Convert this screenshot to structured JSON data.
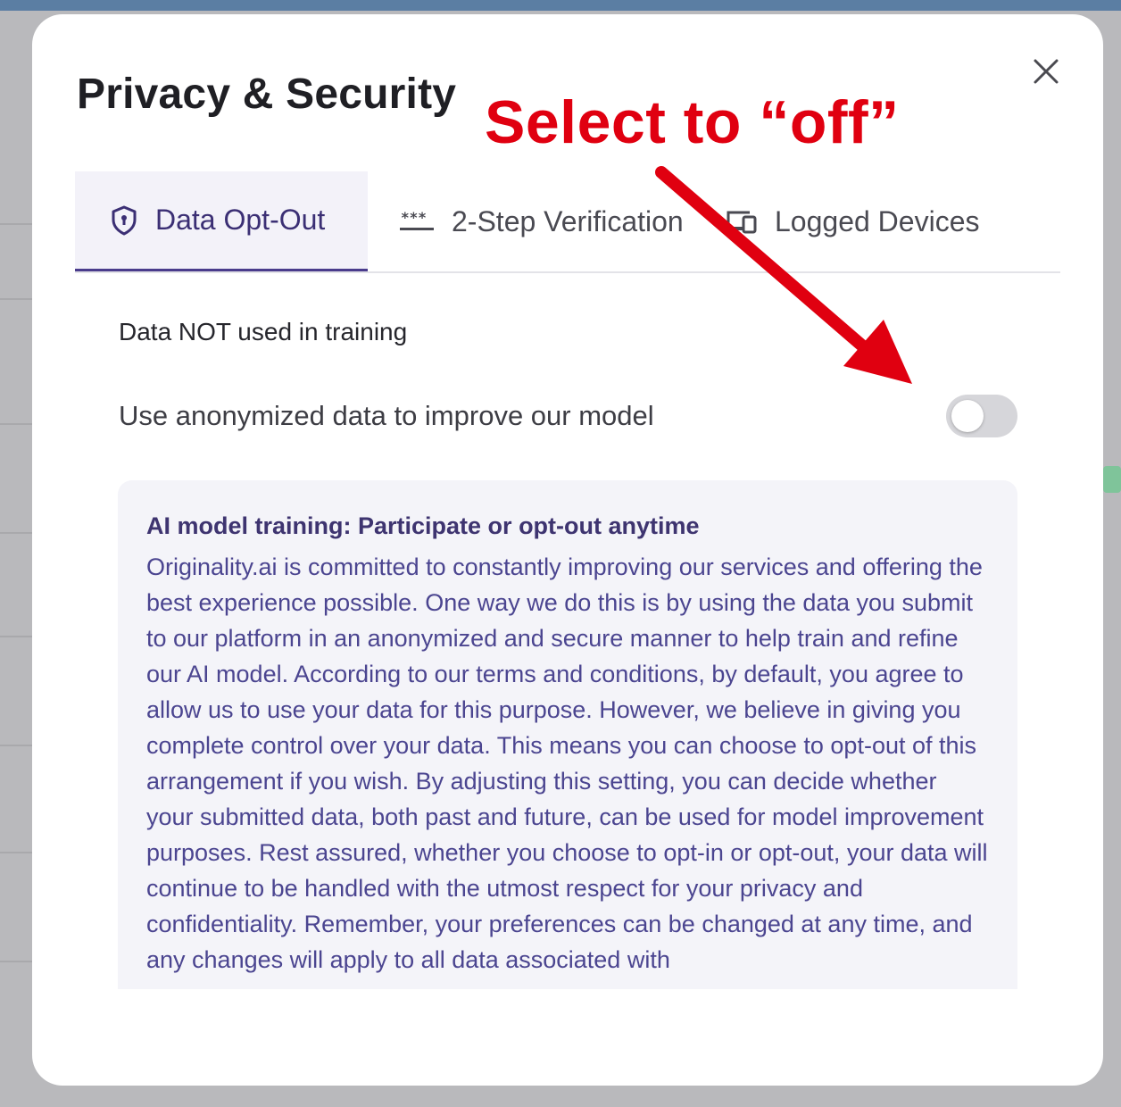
{
  "colors": {
    "accent": "#4a3c8c",
    "annotation_red": "#e00010",
    "toggle_off": "#d6d6da",
    "infobox_bg": "#f4f4f9"
  },
  "modal": {
    "title": "Privacy & Security",
    "close_icon": "close-icon"
  },
  "tabs": [
    {
      "label": "Data Opt-Out",
      "icon": "shield-icon",
      "active": true
    },
    {
      "label": "2-Step Verification",
      "icon": "password-icon",
      "active": false
    },
    {
      "label": "Logged Devices",
      "icon": "devices-icon",
      "active": false
    }
  ],
  "content": {
    "section_label": "Data NOT used in training",
    "setting_label": "Use anonymized data to improve our model",
    "toggle_state": "off",
    "info_title": "AI model training: Participate or opt-out anytime",
    "info_body": "Originality.ai is committed to constantly improving our services and offering the best experience possible. One way we do this is by using the data you submit to our platform in an anonymized and secure manner to help train and refine our AI model. According to our terms and conditions, by default, you agree to allow us to use your data for this purpose. However, we believe in giving you complete control over your data. This means you can choose to opt-out of this arrangement if you wish. By adjusting this setting, you can decide whether your submitted data, both past and future, can be used for model improvement purposes. Rest assured, whether you choose to opt-in or opt-out, your data will continue to be handled with the utmost respect for your privacy and confidentiality. Remember, your preferences can be changed at any time, and any changes will apply to all data associated with"
  },
  "annotation": {
    "text": "Select to “off”"
  }
}
